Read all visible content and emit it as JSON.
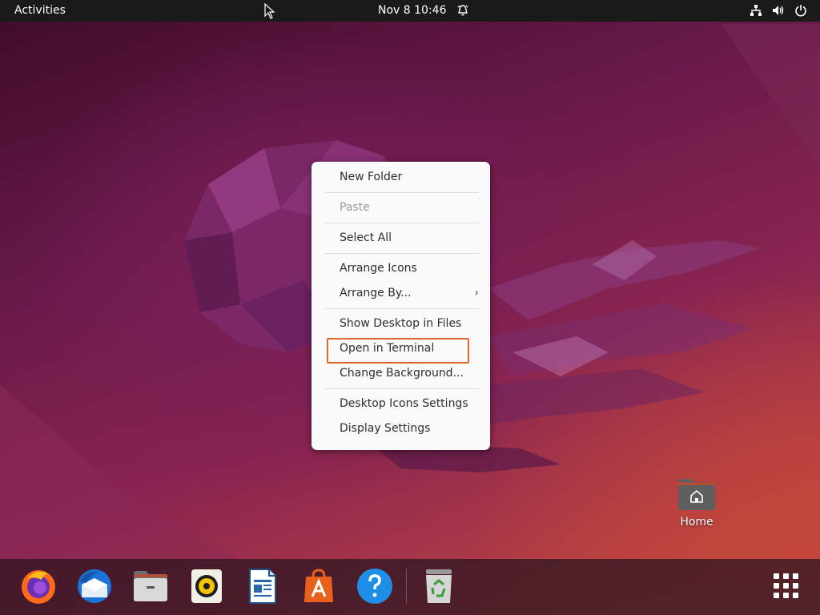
{
  "topbar": {
    "activities": "Activities",
    "clock": "Nov 8  10:46",
    "tray_icons": [
      "network-icon",
      "volume-icon",
      "power-icon"
    ],
    "alarm_icon": "alarm-bell-icon"
  },
  "context_menu": {
    "items": [
      {
        "label": "New Folder",
        "enabled": true
      },
      {
        "label": "Paste",
        "enabled": false
      },
      {
        "label": "Select All",
        "enabled": true
      },
      {
        "label": "Arrange Icons",
        "enabled": true
      },
      {
        "label": "Arrange By...",
        "enabled": true,
        "submenu": true
      },
      {
        "label": "Show Desktop in Files",
        "enabled": true
      },
      {
        "label": "Open in Terminal",
        "enabled": true,
        "highlighted": true
      },
      {
        "label": "Change Background...",
        "enabled": true
      },
      {
        "label": "Desktop Icons Settings",
        "enabled": true
      },
      {
        "label": "Display Settings",
        "enabled": true
      }
    ],
    "submenu_arrow": "›",
    "highlight_color": "#e0692a"
  },
  "desktop": {
    "home_label": "Home"
  },
  "dock": {
    "items": [
      "firefox-icon",
      "thunderbird-icon",
      "files-icon",
      "rhythmbox-icon",
      "libreoffice-writer-icon",
      "app-center-icon",
      "help-icon",
      "trash-icon"
    ],
    "show_apps_icon": "show-applications-icon"
  },
  "colors": {
    "topbar": "#1a1a1a",
    "menu_bg": "#fafafa",
    "accent": "#e95420"
  }
}
